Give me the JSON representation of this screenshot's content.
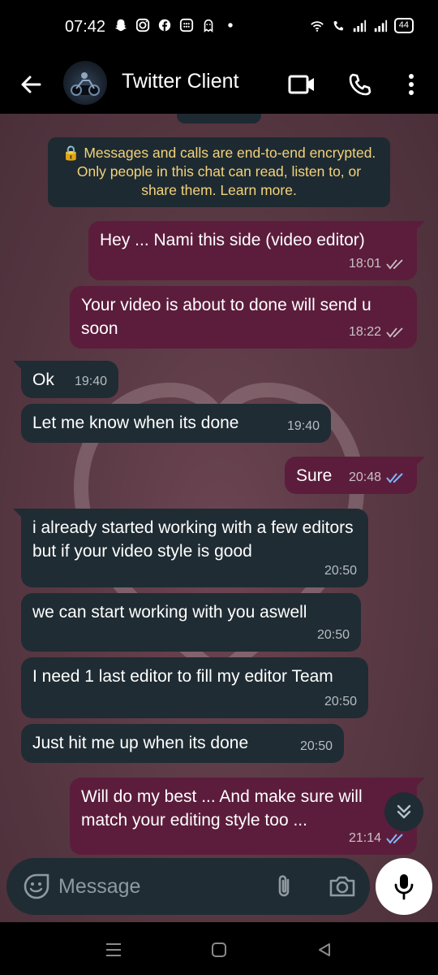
{
  "status_bar": {
    "time": "07:42",
    "battery": "44",
    "left_icons": [
      "snapchat-icon",
      "instagram-icon",
      "facebook-icon",
      "app-icon",
      "ghost-icon",
      "dot-icon"
    ],
    "right_icons": [
      "wifi-icon",
      "volte-icon",
      "signal-icon",
      "signal-icon"
    ]
  },
  "header": {
    "title": "Twitter Client",
    "icons": [
      "back-arrow-icon",
      "video-call-icon",
      "phone-icon",
      "more-vert-icon"
    ]
  },
  "encryption_notice": {
    "text": "🔒 Messages and calls are end-to-end encrypted. Only people in this chat can read, listen to, or share them. Learn more."
  },
  "messages": [
    {
      "dir": "out",
      "text": "Hey ... Nami this side (video editor)",
      "time": "18:01",
      "status": "delivered"
    },
    {
      "dir": "out",
      "text": "Your video is about to done will send u soon",
      "time": "18:22",
      "status": "delivered"
    },
    {
      "dir": "in",
      "text": "Ok",
      "time": "19:40"
    },
    {
      "dir": "in",
      "text": "Let me know when its done",
      "time": "19:40"
    },
    {
      "dir": "out",
      "text": "Sure",
      "time": "20:48",
      "status": "read"
    },
    {
      "dir": "in",
      "text": "i already started working with a few editors but if your video style is good",
      "time": "20:50"
    },
    {
      "dir": "in",
      "text": "we can start working with you aswell",
      "time": "20:50"
    },
    {
      "dir": "in",
      "text": "I need 1 last editor to fill my editor Team",
      "time": "20:50"
    },
    {
      "dir": "in",
      "text": "Just hit me up when its done",
      "time": "20:50"
    },
    {
      "dir": "out",
      "text": "Will do my best ... And make sure will match your editing style too ...",
      "time": "21:14",
      "status": "read"
    }
  ],
  "composer": {
    "placeholder": "Message",
    "icons": [
      "emoji-sticker-icon",
      "attach-icon",
      "camera-icon",
      "mic-icon"
    ]
  },
  "nav": {
    "icons": [
      "menu-icon",
      "home-icon",
      "back-icon"
    ]
  },
  "colors": {
    "outgoing_bubble": "#5c1d3c",
    "incoming_bubble": "#1f2c33",
    "notice_text": "#f3d37a",
    "read_ticks": "#7fb8ff",
    "delivered_ticks": "#c9c2c6"
  }
}
